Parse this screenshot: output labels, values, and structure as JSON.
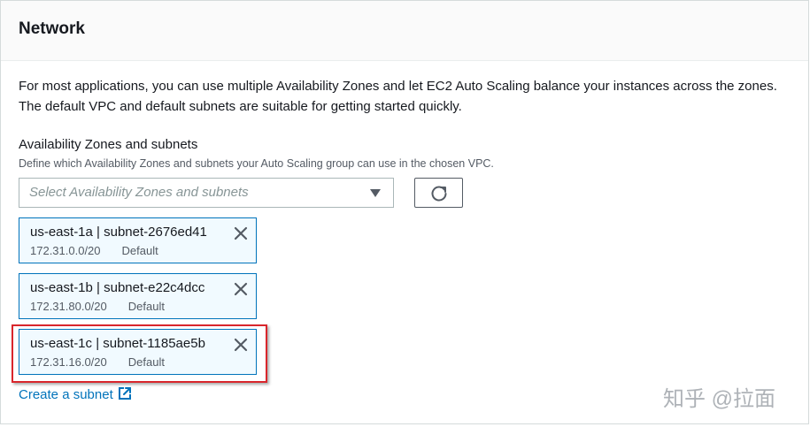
{
  "section": {
    "title": "Network",
    "intro": "For most applications, you can use multiple Availability Zones and let EC2 Auto Scaling balance your instances across the zones. The default VPC and default subnets are suitable for getting started quickly."
  },
  "az_field": {
    "label": "Availability Zones and subnets",
    "description": "Define which Availability Zones and subnets your Auto Scaling group can use in the chosen VPC.",
    "placeholder": "Select Availability Zones and subnets"
  },
  "tokens": [
    {
      "title": "us-east-1a | subnet-2676ed41",
      "cidr": "172.31.0.0/20",
      "tag": "Default"
    },
    {
      "title": "us-east-1b | subnet-e22c4dcc",
      "cidr": "172.31.80.0/20",
      "tag": "Default"
    },
    {
      "title": "us-east-1c | subnet-1185ae5b",
      "cidr": "172.31.16.0/20",
      "tag": "Default"
    }
  ],
  "create_subnet": {
    "label": "Create a subnet"
  },
  "watermark": "知乎 @拉面",
  "colors": {
    "accent": "#0073bb",
    "token_bg": "#f1faff",
    "highlight": "#d9262c"
  }
}
